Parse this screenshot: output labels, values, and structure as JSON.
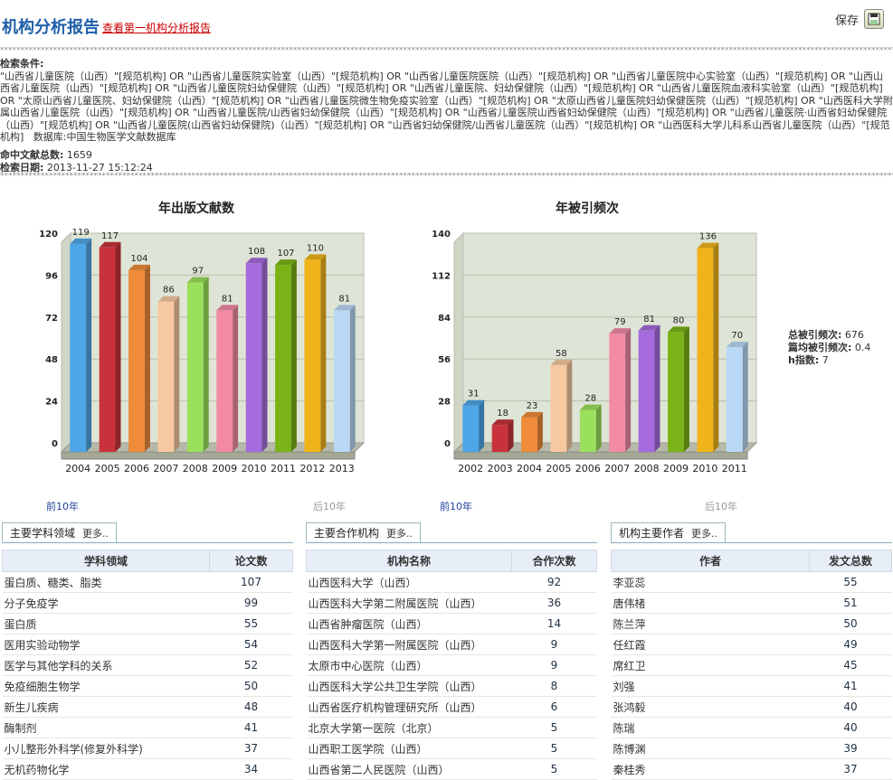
{
  "header": {
    "title": "机构分析报告",
    "link": "查看第一机构分析报告",
    "save_label": "保存"
  },
  "query": {
    "label": "检索条件:",
    "text": "\"山西省儿童医院（山西）\"[规范机构] OR \"山西省儿童医院实验室（山西）\"[规范机构] OR \"山西省儿童医院医院（山西）\"[规范机构] OR \"山西省儿童医院中心实验室（山西）\"[规范机构] OR \"山西山西省儿童医院（山西）\"[规范机构] OR \"山西省儿童医院妇幼保健院（山西）\"[规范机构] OR \"山西省儿童医院、妇幼保健院（山西）\"[规范机构] OR \"山西省儿童医院血液科实验室（山西）\"[规范机构] OR \"太原山西省儿童医院、妇幼保健院（山西）\"[规范机构] OR \"山西省儿童医院微生物免疫实验室（山西）\"[规范机构] OR \"太原山西省儿童医院妇幼保健医院（山西）\"[规范机构] OR \"山西医科大学附属山西省儿童医院（山西）\"[规范机构] OR \"山西省儿童医院/山西省妇幼保健院（山西）\"[规范机构] OR \"山西省儿童医院山西省妇幼保健院（山西）\"[规范机构] OR \"山西省儿童医院·山西省妇幼保健院（山西）\"[规范机构] OR \"山西省儿童医院(山西省妇幼保健院)（山西）\"[规范机构] OR \"山西省妇幼保健院/山西省儿童医院（山西）\"[规范机构] OR \"山西医科大学儿科系山西省儿童医院（山西）\"[规范机构]",
    "database": "数据库:中国生物医学文献数据库",
    "hits_label": "命中文献总数:",
    "hits_value": "1659",
    "date_label": "检索日期:",
    "date_value": "2013-11-27 15:12:24"
  },
  "chart_data": [
    {
      "type": "bar",
      "title": "年出版文献数",
      "categories": [
        "2004",
        "2005",
        "2006",
        "2007",
        "2008",
        "2009",
        "2010",
        "2011",
        "2012",
        "2013"
      ],
      "values": [
        119,
        117,
        104,
        86,
        97,
        81,
        108,
        107,
        110,
        81
      ],
      "yticks": [
        0,
        24,
        48,
        72,
        96,
        120
      ],
      "ylim": [
        0,
        120
      ],
      "colors": [
        "#4ea6e6",
        "#c8333b",
        "#f08b3a",
        "#f7c9a0",
        "#9be05c",
        "#f28aa6",
        "#a66bdc",
        "#7ab317",
        "#f0b41a",
        "#b9d8f5"
      ],
      "nav": {
        "prev": "前10年",
        "next": "后10年"
      }
    },
    {
      "type": "bar",
      "title": "年被引频次",
      "categories": [
        "2002",
        "2003",
        "2004",
        "2005",
        "2006",
        "2007",
        "2008",
        "2009",
        "2010",
        "2011"
      ],
      "values": [
        31,
        18,
        23,
        58,
        28,
        79,
        81,
        80,
        136,
        70
      ],
      "yticks": [
        0,
        28,
        56,
        84,
        112,
        140
      ],
      "ylim": [
        0,
        140
      ],
      "colors": [
        "#4ea6e6",
        "#c8333b",
        "#f08b3a",
        "#f7c9a0",
        "#9be05c",
        "#f28aa6",
        "#a66bdc",
        "#7ab317",
        "#f0b41a",
        "#b9d8f5"
      ],
      "nav": {
        "prev": "前10年",
        "next": "后10年"
      }
    }
  ],
  "stats": {
    "total_cited_label": "总被引频次:",
    "total_cited_value": "676",
    "avg_cited_label": "篇均被引频次:",
    "avg_cited_value": "0.4",
    "h_label": "h指数:",
    "h_value": "7"
  },
  "panels": [
    {
      "tab": "主要学科领域",
      "more": "更多..",
      "headers": [
        "学科领域",
        "论文数"
      ],
      "rows": [
        [
          "蛋白质、糖类、脂类",
          "107"
        ],
        [
          "分子免疫学",
          "99"
        ],
        [
          "蛋白质",
          "55"
        ],
        [
          "医用实验动物学",
          "54"
        ],
        [
          "医学与其他学科的关系",
          "52"
        ],
        [
          "免疫细胞生物学",
          "50"
        ],
        [
          "新生儿疾病",
          "48"
        ],
        [
          "酶制剂",
          "41"
        ],
        [
          "小儿整形外科学(修复外科学)",
          "37"
        ],
        [
          "无机药物化学",
          "34"
        ]
      ]
    },
    {
      "tab": "主要合作机构",
      "more": "更多..",
      "headers": [
        "机构名称",
        "合作次数"
      ],
      "rows": [
        [
          "山西医科大学（山西）",
          "92"
        ],
        [
          "山西医科大学第二附属医院（山西）",
          "36"
        ],
        [
          "山西省肿瘤医院（山西）",
          "14"
        ],
        [
          "山西医科大学第一附属医院（山西）",
          "9"
        ],
        [
          "太原市中心医院（山西）",
          "9"
        ],
        [
          "山西医科大学公共卫生学院（山西）",
          "8"
        ],
        [
          "山西省医疗机构管理研究所（山西）",
          "6"
        ],
        [
          "北京大学第一医院（北京）",
          "5"
        ],
        [
          "山西职工医学院（山西）",
          "5"
        ],
        [
          "山西省第二人民医院（山西）",
          "5"
        ]
      ]
    },
    {
      "tab": "机构主要作者",
      "more": "更多..",
      "headers": [
        "作者",
        "发文总数"
      ],
      "rows": [
        [
          "李亚蕊",
          "55"
        ],
        [
          "唐伟楮",
          "51"
        ],
        [
          "陈兰萍",
          "50"
        ],
        [
          "任红霞",
          "49"
        ],
        [
          "席红卫",
          "45"
        ],
        [
          "刘强",
          "41"
        ],
        [
          "张鸿毅",
          "40"
        ],
        [
          "陈瑞",
          "40"
        ],
        [
          "陈博渊",
          "39"
        ],
        [
          "秦桂秀",
          "37"
        ]
      ]
    }
  ]
}
